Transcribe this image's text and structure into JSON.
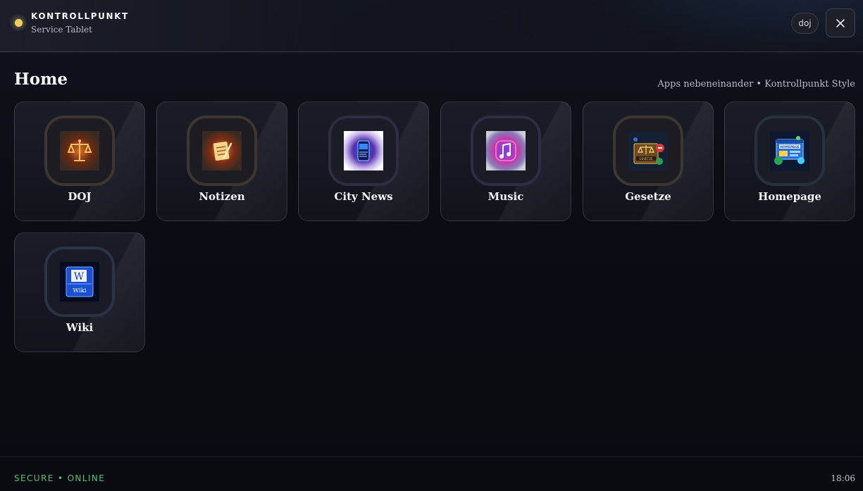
{
  "header": {
    "brand_title": "KONTROLLPUNKT",
    "brand_subtitle": "Service Tablet",
    "user_label": "doj",
    "close_icon": "close-icon",
    "status_color": "#f5cf5b"
  },
  "main": {
    "title": "Home",
    "hint": "Apps nebeneinander • Kontrollpunkt Style",
    "apps": [
      {
        "label": "DOJ",
        "icon": "scales-of-justice-icon",
        "accent": "#4a4034"
      },
      {
        "label": "Notizen",
        "icon": "notepad-icon",
        "accent": "#4a4034"
      },
      {
        "label": "City News",
        "icon": "news-phone-icon",
        "accent": "#393650"
      },
      {
        "label": "Music",
        "icon": "music-note-icon",
        "accent": "#393650"
      },
      {
        "label": "Gesetze",
        "icon": "law-book-icon",
        "accent": "#4a4034"
      },
      {
        "label": "Homepage",
        "icon": "homepage-browser-icon",
        "accent": "#303c4c"
      },
      {
        "label": "Wiki",
        "icon": "wiki-book-icon",
        "accent": "#363d58"
      }
    ]
  },
  "wiki_icon_text": {
    "letter": "W",
    "caption": "Wiki"
  },
  "homepage_icon_text": "HOMEPAGE",
  "gesetze_icon_text": "GESETZE",
  "footer": {
    "status": "SECURE • ONLINE",
    "time": "18:06"
  }
}
